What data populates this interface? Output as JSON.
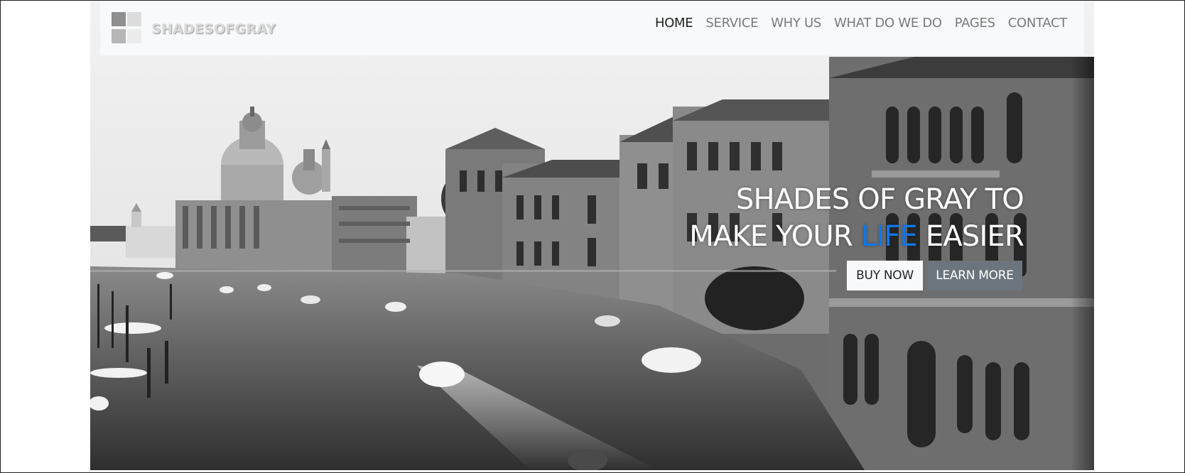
{
  "brand": {
    "name": "SHADESOFGRAY",
    "logo_icon": "four-squares-logo-icon"
  },
  "nav": {
    "items": [
      {
        "label": "HOME",
        "active": true
      },
      {
        "label": "SERVICE",
        "active": false
      },
      {
        "label": "WHY US",
        "active": false
      },
      {
        "label": "WHAT DO WE DO",
        "active": false
      },
      {
        "label": "PAGES",
        "active": false
      },
      {
        "label": "CONTACT",
        "active": false
      }
    ]
  },
  "hero": {
    "line1": "SHADES OF GRAY TO",
    "line2_prefix": "MAKE YOUR ",
    "line2_accent": "LIFE",
    "line2_suffix": " EASIER",
    "buy_label": "BUY NOW",
    "learn_label": "LEARN MORE",
    "background_image": "grayscale-venice-grand-canal-photo"
  },
  "colors": {
    "accent": "#1177e8",
    "navbar_bg": "#f8f9fa",
    "secondary_button": "#6c757d"
  }
}
